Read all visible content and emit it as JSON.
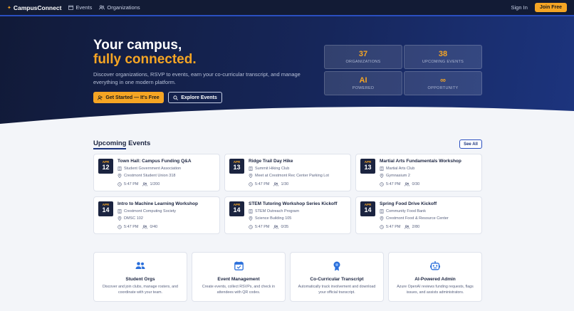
{
  "nav": {
    "brand": "CampusConnect",
    "events_label": "Events",
    "orgs_label": "Organizations",
    "signin_label": "Sign In",
    "join_label": "Join Free"
  },
  "hero": {
    "title_line1": "Your campus,",
    "title_line2": "fully connected.",
    "subtitle": "Discover organizations, RSVP to events, earn your co-curricular transcript, and manage everything in one modern platform.",
    "cta_primary": "Get Started — It's Free",
    "cta_secondary": "Explore Events",
    "stats": [
      {
        "value": "37",
        "label": "ORGANIZATIONS"
      },
      {
        "value": "38",
        "label": "UPCOMING EVENTS"
      },
      {
        "value": "AI",
        "label": "POWERED"
      },
      {
        "value": "∞",
        "label": "OPPORTUNITY"
      }
    ]
  },
  "upcoming": {
    "title": "Upcoming Events",
    "see_all": "See All",
    "events": [
      {
        "month": "APR",
        "day": "12",
        "title": "Town Hall: Campus Funding Q&A",
        "org": "Student Government Association",
        "location": "Crestmont Student Union 318",
        "time": "5:47 PM",
        "count": "1/200"
      },
      {
        "month": "APR",
        "day": "13",
        "title": "Ridge Trail Day Hike",
        "org": "Summit Hiking Club",
        "location": "Meet at Crestmont Rec Center Parking Lot",
        "time": "5:47 PM",
        "count": "1/30"
      },
      {
        "month": "APR",
        "day": "13",
        "title": "Martial Arts Fundamentals Workshop",
        "org": "Martial Arts Club",
        "location": "Gymnasium 2",
        "time": "5:47 PM",
        "count": "0/30"
      },
      {
        "month": "APR",
        "day": "14",
        "title": "Intro to Machine Learning Workshop",
        "org": "Crestmont Computing Society",
        "location": "DMSC 102",
        "time": "5:47 PM",
        "count": "0/40"
      },
      {
        "month": "APR",
        "day": "14",
        "title": "STEM Tutoring Workshop Series Kickoff",
        "org": "STEM Outreach Program",
        "location": "Science Building 105",
        "time": "5:47 PM",
        "count": "0/35"
      },
      {
        "month": "APR",
        "day": "14",
        "title": "Spring Food Drive Kickoff",
        "org": "Community Food Bank",
        "location": "Crestmont Food & Resource Center",
        "time": "5:47 PM",
        "count": "2/80"
      }
    ]
  },
  "features": [
    {
      "icon": "users-icon",
      "title": "Student Orgs",
      "desc": "Discover and join clubs, manage rosters, and coordinate with your team."
    },
    {
      "icon": "calendar-icon",
      "title": "Event Management",
      "desc": "Create events, collect RSVPs, and check in attendees with QR codes."
    },
    {
      "icon": "award-icon",
      "title": "Co-Curricular Transcript",
      "desc": "Automatically track involvement and download your official transcript."
    },
    {
      "icon": "robot-icon",
      "title": "AI-Powered Admin",
      "desc": "Azure OpenAI reviews funding requests, flags issues, and assists administrators."
    }
  ],
  "colors": {
    "accent": "#f5a524",
    "navy": "#121b35",
    "brand_blue": "#1c347e"
  }
}
